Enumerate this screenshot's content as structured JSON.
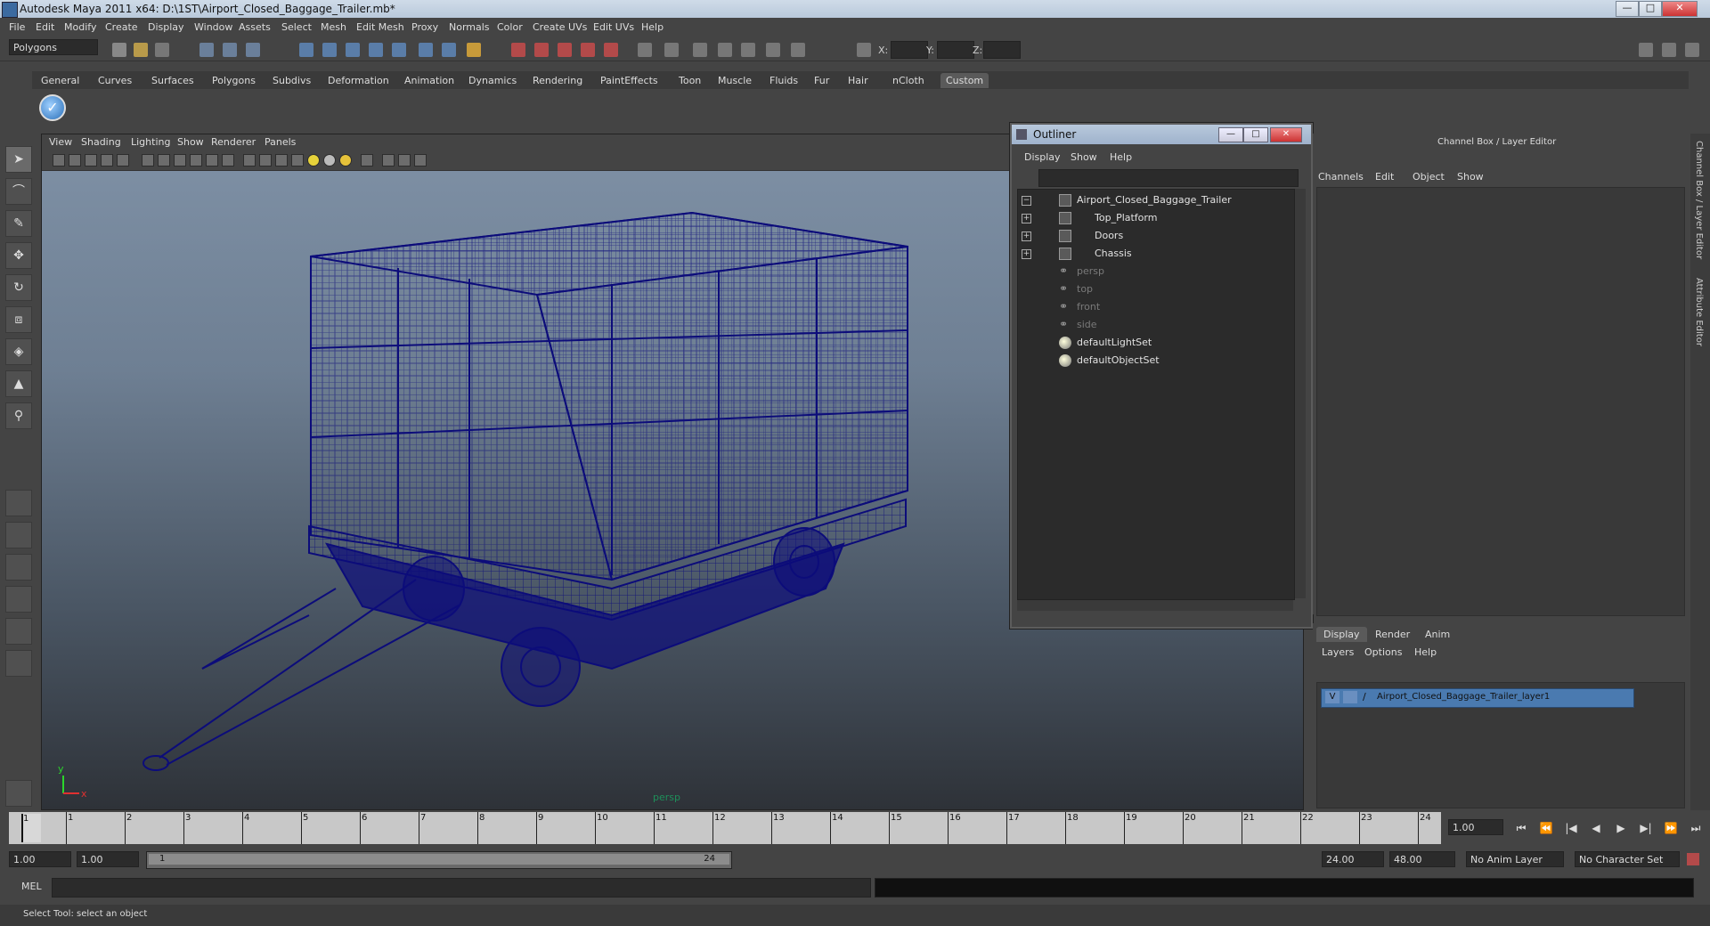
{
  "window": {
    "title": "Autodesk Maya 2011 x64: D:\\1ST\\Airport_Closed_Baggage_Trailer.mb*",
    "controls": {
      "minimize": "—",
      "maximize": "□",
      "close": "✕"
    }
  },
  "menubar": [
    "File",
    "Edit",
    "Modify",
    "Create",
    "Display",
    "Window",
    "Assets",
    "Select",
    "Mesh",
    "Edit Mesh",
    "Proxy",
    "Normals",
    "Color",
    "Create UVs",
    "Edit UVs",
    "Help"
  ],
  "status_line": {
    "mode": "Polygons",
    "x_label": "X:",
    "y_label": "Y:",
    "z_label": "Z:"
  },
  "shelf": {
    "tabs": [
      "General",
      "Curves",
      "Surfaces",
      "Polygons",
      "Subdivs",
      "Deformation",
      "Animation",
      "Dynamics",
      "Rendering",
      "PaintEffects",
      "Toon",
      "Muscle",
      "Fluids",
      "Fur",
      "Hair",
      "nCloth",
      "Custom"
    ],
    "active_tab": "Custom",
    "buttons": [
      {
        "icon": "checkmark-icon",
        "glyph": "✓"
      }
    ]
  },
  "toolbox": {
    "tools": [
      {
        "name": "select-tool",
        "glyph": "➤",
        "active": true
      },
      {
        "name": "lasso-tool",
        "glyph": "⌒"
      },
      {
        "name": "paint-select-tool",
        "glyph": "✎"
      },
      {
        "name": "move-tool",
        "glyph": "✥"
      },
      {
        "name": "rotate-tool",
        "glyph": "↻"
      },
      {
        "name": "scale-tool",
        "glyph": "⧈"
      },
      {
        "name": "manipulator-tool",
        "glyph": "◈"
      },
      {
        "name": "soft-mod-tool",
        "glyph": "▲"
      },
      {
        "name": "last-tool",
        "glyph": "⚲"
      }
    ]
  },
  "viewport": {
    "menu": [
      "View",
      "Shading",
      "Lighting",
      "Show",
      "Renderer",
      "Panels"
    ],
    "camera_label": "persp",
    "axis_y": "y",
    "axis_x": "x"
  },
  "outliner": {
    "title": "Outliner",
    "menu": [
      "Display",
      "Show",
      "Help"
    ],
    "items": [
      {
        "label": "Airport_Closed_Baggage_Trailer",
        "type": "transform",
        "expand": "−",
        "indent": 0,
        "dim": false
      },
      {
        "label": "Top_Platform",
        "type": "transform",
        "expand": "+",
        "indent": 1,
        "dim": false
      },
      {
        "label": "Doors",
        "type": "transform",
        "expand": "+",
        "indent": 1,
        "dim": false
      },
      {
        "label": "Chassis",
        "type": "transform",
        "expand": "+",
        "indent": 1,
        "dim": false
      },
      {
        "label": "persp",
        "type": "camera",
        "expand": "",
        "indent": 0,
        "dim": true
      },
      {
        "label": "top",
        "type": "camera",
        "expand": "",
        "indent": 0,
        "dim": true
      },
      {
        "label": "front",
        "type": "camera",
        "expand": "",
        "indent": 0,
        "dim": true
      },
      {
        "label": "side",
        "type": "camera",
        "expand": "",
        "indent": 0,
        "dim": true
      },
      {
        "label": "defaultLightSet",
        "type": "set",
        "expand": "",
        "indent": 0,
        "dim": false
      },
      {
        "label": "defaultObjectSet",
        "type": "set",
        "expand": "",
        "indent": 0,
        "dim": false
      }
    ]
  },
  "channel_box": {
    "title": "Channel Box / Layer Editor",
    "menu": [
      "Channels",
      "Edit",
      "Object",
      "Show"
    ]
  },
  "side_tabs": [
    "Channel Box / Layer Editor",
    "Attribute Editor"
  ],
  "layer_editor": {
    "tabs": [
      "Display",
      "Render",
      "Anim"
    ],
    "active_tab": "Display",
    "menu": [
      "Layers",
      "Options",
      "Help"
    ],
    "layers": [
      {
        "visible": "V",
        "name": "Airport_Closed_Baggage_Trailer_layer1"
      }
    ]
  },
  "timeline": {
    "frames": [
      "1",
      "2",
      "3",
      "4",
      "5",
      "6",
      "7",
      "8",
      "9",
      "10",
      "11",
      "12",
      "13",
      "14",
      "15",
      "16",
      "17",
      "18",
      "19",
      "20",
      "21",
      "22",
      "23",
      "24"
    ],
    "current_frame_label": "1",
    "current_time": "1.00",
    "playback": [
      "⏮",
      "⏪",
      "|◀",
      "◀",
      "▶",
      "▶|",
      "⏩",
      "⏭"
    ]
  },
  "range": {
    "start": "1.00",
    "playback_start": "1.00",
    "slider_start": "1",
    "slider_end": "24",
    "playback_end": "24.00",
    "end": "48.00",
    "anim_layer": "No Anim Layer",
    "character_set": "No Character Set"
  },
  "command_line": {
    "label": "MEL"
  },
  "help_line": {
    "text": "Select Tool: select an object"
  },
  "colors": {
    "wireframe": "#0c0c7a",
    "viewport_top": "#7f91a6",
    "viewport_bottom": "#2e3238",
    "selected_layer": "#4a7ab0"
  }
}
